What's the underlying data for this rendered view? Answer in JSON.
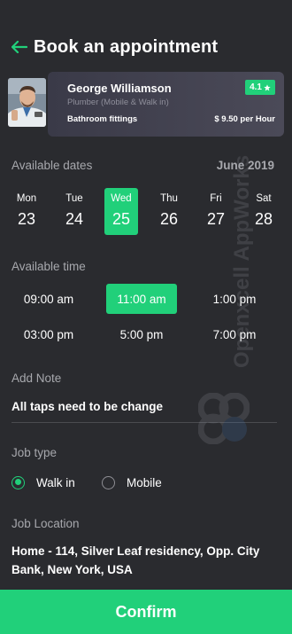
{
  "header": {
    "title": "Book an appointment",
    "back_icon": "arrow-left-icon"
  },
  "provider": {
    "name": "George Williamson",
    "role": "Plumber (Mobile & Walk in)",
    "rating": "4.1",
    "rating_icon": "star-icon",
    "service": "Bathroom fittings",
    "price": "$ 9.50 per Hour"
  },
  "dates": {
    "label": "Available dates",
    "month": "June 2019",
    "items": [
      {
        "dow": "Mon",
        "day": "23",
        "selected": false
      },
      {
        "dow": "Tue",
        "day": "24",
        "selected": false
      },
      {
        "dow": "Wed",
        "day": "25",
        "selected": true
      },
      {
        "dow": "Thu",
        "day": "26",
        "selected": false
      },
      {
        "dow": "Fri",
        "day": "27",
        "selected": false
      },
      {
        "dow": "Sat",
        "day": "28",
        "selected": false
      }
    ]
  },
  "times": {
    "label": "Available time",
    "slots": [
      {
        "label": "09:00 am",
        "selected": false
      },
      {
        "label": "11:00 am",
        "selected": true
      },
      {
        "label": "1:00 pm",
        "selected": false
      },
      {
        "label": "03:00 pm",
        "selected": false
      },
      {
        "label": "5:00 pm",
        "selected": false
      },
      {
        "label": "7:00 pm",
        "selected": false
      }
    ]
  },
  "note": {
    "label": "Add Note",
    "value": "All taps need to be change"
  },
  "job_type": {
    "label": "Job type",
    "options": [
      {
        "label": "Walk in",
        "checked": true
      },
      {
        "label": "Mobile",
        "checked": false
      }
    ]
  },
  "location": {
    "label": "Job Location",
    "value": "Home - 114, Silver Leaf residency, Opp. City Bank, New York, USA"
  },
  "confirm_label": "Confirm",
  "watermark": {
    "text": "Openxcell AppWorks"
  },
  "colors": {
    "accent": "#21d07a",
    "background": "#2a2b2f",
    "card": "#44434f",
    "muted": "#a7a8ad"
  }
}
